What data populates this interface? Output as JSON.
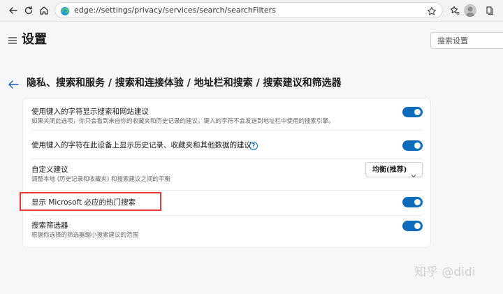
{
  "browser": {
    "url": "edge://settings/privacy/services/search/searchFilters",
    "icons": [
      "back-icon",
      "refresh-icon",
      "home-icon",
      "edge-logo-icon",
      "star-icon",
      "favorites-icon",
      "collections-icon",
      "profile-avatar",
      "more-icon"
    ]
  },
  "header": {
    "title": "设置",
    "search_placeholder": "搜索设置"
  },
  "breadcrumb": {
    "text": "隐私、搜索和服务 / 搜索和连接体验 / 地址栏和搜索 / 搜索建议和筛选器"
  },
  "settings": {
    "items": [
      {
        "title": "使用键入的字符显示搜索和网站建议",
        "description": "如果关闭此选项，你只会看到来自你的收藏夹和历史记录的建议。键入的字符不会发送到地址栏中使用的搜索引擎。",
        "control": "toggle",
        "on": true
      },
      {
        "title": "使用键入的字符在此设备上显示历史记录、收藏夹和其他数据的建议",
        "help_icon": "?",
        "control": "toggle",
        "on": true
      },
      {
        "title": "自定义建议",
        "description": "调整本地 (历史记录和收藏夹) 和搜索建议之间的平衡",
        "control": "select",
        "value": "均衡(推荐)"
      },
      {
        "title": "显示 Microsoft 必应的热门搜索",
        "control": "toggle",
        "on": true,
        "highlighted": true
      },
      {
        "title": "搜索筛选器",
        "description": "根据你选择的筛选器缩小搜索建议的范围",
        "control": "toggle",
        "on": true
      }
    ]
  },
  "colors": {
    "accent": "#0f6cbd",
    "highlight": "#e53935",
    "background": "#f7f7f7"
  },
  "watermark": {
    "text": "知乎 @didi"
  }
}
